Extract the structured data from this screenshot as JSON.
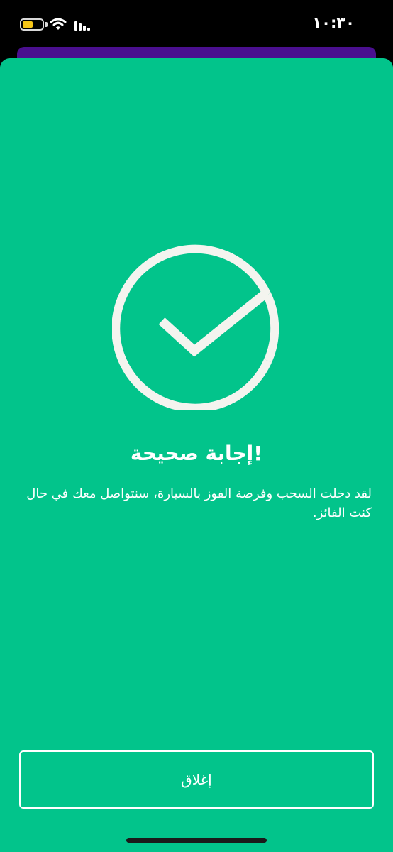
{
  "status_bar": {
    "time": "١٠:٣٠",
    "battery_level": 0.55,
    "battery_color": "#f5c518",
    "icons": [
      "battery-icon",
      "wifi-icon",
      "cellular-signal-icon"
    ]
  },
  "sheet": {
    "background_color": "#02c48b",
    "back_sheet_color": "#4a0f8f",
    "icon": "check-circle-icon",
    "title": "إجابة صحيحة!",
    "message": "لقد دخلت السحب وفرصة الفوز بالسيارة، سنتواصل معك في حال كنت الفائز.",
    "close_label": "إغلاق"
  }
}
